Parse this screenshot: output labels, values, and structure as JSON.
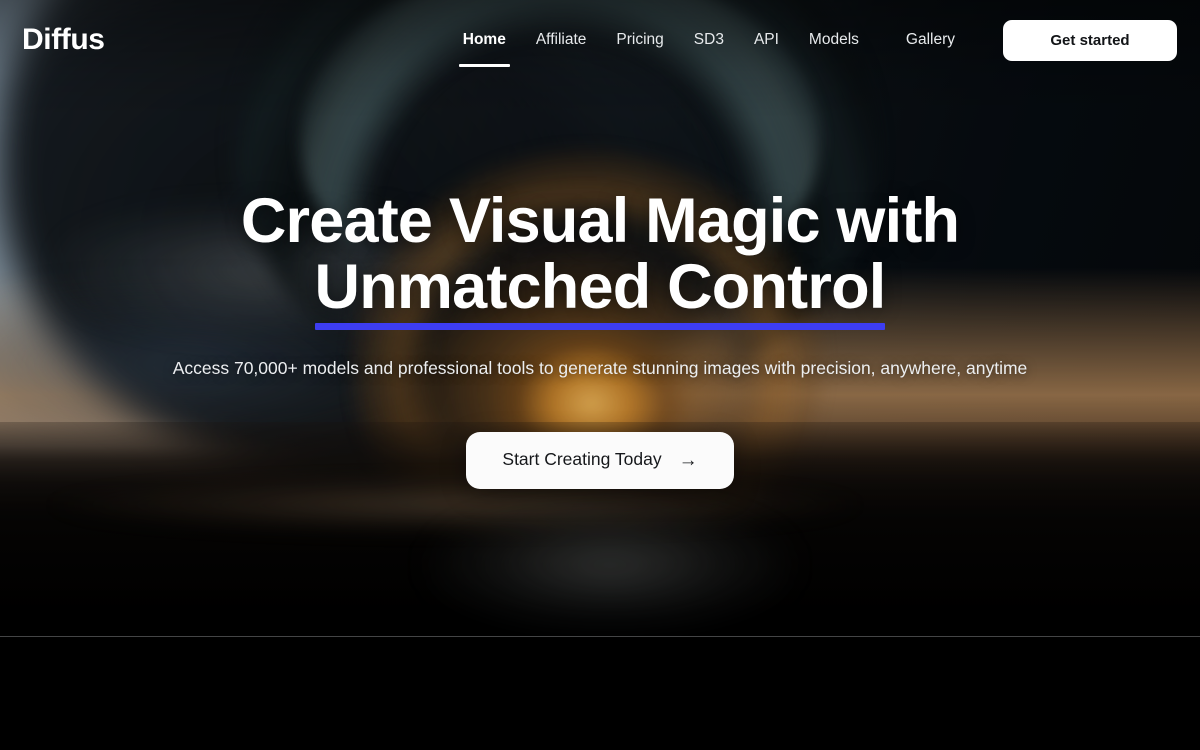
{
  "brand": {
    "name": "Diffus"
  },
  "header": {
    "nav": [
      {
        "label": "Home",
        "active": true
      },
      {
        "label": "Affiliate",
        "active": false
      },
      {
        "label": "Pricing",
        "active": false
      },
      {
        "label": "SD3",
        "active": false
      },
      {
        "label": "API",
        "active": false
      },
      {
        "label": "Models",
        "active": false
      },
      {
        "label": "Gallery",
        "active": false
      }
    ],
    "cta_label": "Get started"
  },
  "hero": {
    "headline_line1": "Create Visual Magic with",
    "headline_line2": "Unmatched Control",
    "subheadline": "Access 70,000+ models and professional tools to generate stunning images with precision, anywhere, anytime",
    "cta_label": "Start Creating Today",
    "cta_arrow": "→"
  },
  "colors": {
    "accent_underline": "#3d3df2",
    "button_bg": "#ffffff",
    "button_text": "#16181b",
    "page_bg": "#000000",
    "nav_text": "#e7eaec"
  }
}
